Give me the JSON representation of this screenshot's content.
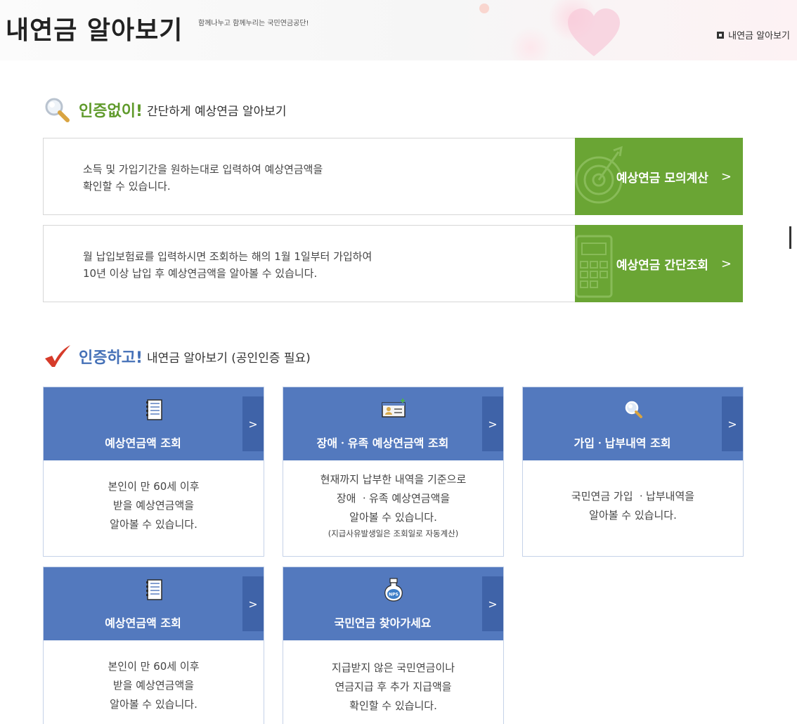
{
  "header": {
    "title": "내연금 알아보기",
    "slogan": "함께나누고 함께누리는 국민연금공단!",
    "breadcrumb": "내연금 알아보기"
  },
  "section1": {
    "strong": "인증없이!",
    "rest": "간단하게 예상연금 알아보기",
    "icon": "magnifier-icon",
    "rows": [
      {
        "lines": [
          "소득 및 가입기간을 원하는대로 입력하여 예상연금액을",
          "확인할 수 있습니다."
        ],
        "button": "예상연금 모의계산",
        "chevron": ">"
      },
      {
        "lines": [
          "월 납입보험료를 입력하시면 조회하는 해의 1월 1일부터 가입하여",
          "10년 이상 납입 후 예상연금액을 알아볼 수 있습니다."
        ],
        "button": "예상연금 간단조회",
        "chevron": ">"
      }
    ]
  },
  "section2": {
    "strong": "인증하고!",
    "rest": "내연금 알아보기 (공인인증 필요)",
    "icon": "checkmark-icon",
    "cards": [
      {
        "title": "예상연금액 조회",
        "icon": "notebook-icon",
        "arrow": ">",
        "lines": [
          "본인이 만 60세 이후",
          "받을 예상연금액을",
          "알아볼 수 있습니다."
        ]
      },
      {
        "title": "장애ㆍ유족 예상연금액 조회",
        "icon": "id-card-icon",
        "arrow": ">",
        "lines": [
          "현재까지 납부한 내역을 기준으로",
          "장애 ㆍ유족 예상연금액을",
          "알아볼 수 있습니다."
        ],
        "note": "(지급사유발생일은 조회일로 자동계산)"
      },
      {
        "title": "가입ㆍ납부내역 조회",
        "icon": "search-icon",
        "arrow": ">",
        "lines": [
          "국민연금 가입 ㆍ납부내역을",
          "알아볼 수 있습니다."
        ]
      },
      {
        "title": "예상연금액 조회",
        "icon": "notebook-icon",
        "arrow": ">",
        "lines": [
          "본인이 만 60세 이후",
          "받을 예상연금액을",
          "알아볼 수 있습니다."
        ]
      },
      {
        "title": "국민연금 찾아가세요",
        "icon": "nps-bottle-icon",
        "icon_text": "NPS",
        "arrow": ">",
        "lines": [
          "지급받지 않은 국민연금이나",
          "연금지급 후 추가 지급액을",
          "확인할 수 있습니다."
        ]
      }
    ]
  },
  "colors": {
    "green": "#6aa534",
    "blue": "#5379be",
    "blue_dark": "#3f63a8",
    "green_text": "#5f9a2b",
    "blue_text": "#4470b7"
  }
}
